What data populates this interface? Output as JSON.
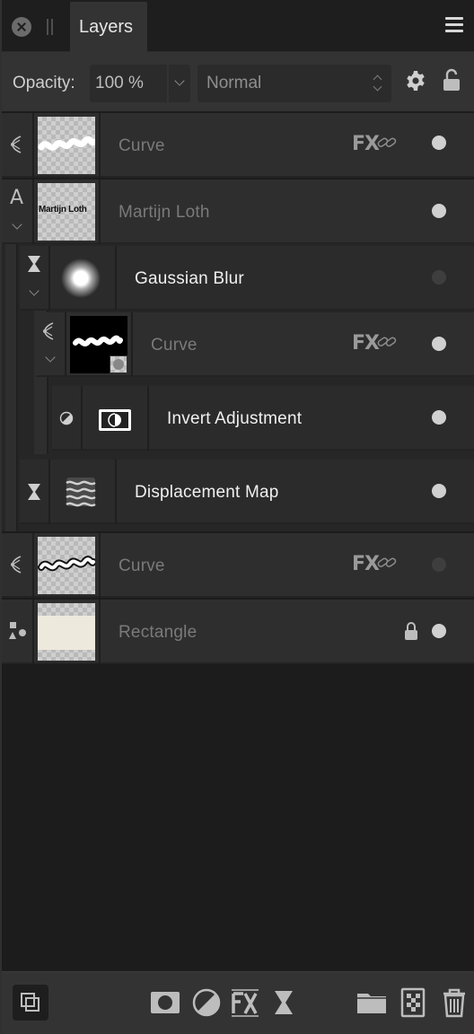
{
  "panel": {
    "tab_label": "Layers"
  },
  "options": {
    "opacity_label": "Opacity:",
    "opacity_value": "100 %",
    "blend_mode": "Normal"
  },
  "layers": [
    {
      "name": "Curve",
      "type": "curve",
      "icon": "pen-node-icon",
      "fx": true,
      "linked": true,
      "visible": true
    },
    {
      "name": "Martijn Loth",
      "type": "text",
      "icon": "text-icon",
      "thumb_text": "Martijn Loth",
      "expanded": true,
      "visible": true
    },
    {
      "name": "Gaussian Blur",
      "type": "filter",
      "icon": "hourglass-icon",
      "expanded": true,
      "visible": false
    },
    {
      "name": "Curve",
      "type": "curve",
      "icon": "pen-node-icon",
      "fx": true,
      "linked": true,
      "expanded": true,
      "visible": true
    },
    {
      "name": "Invert Adjustment",
      "type": "adjustment",
      "icon": "adjustment-icon",
      "visible": true
    },
    {
      "name": "Displacement Map",
      "type": "filter",
      "icon": "hourglass-icon",
      "visible": true
    },
    {
      "name": "Curve",
      "type": "curve",
      "icon": "pen-node-icon",
      "fx": true,
      "linked": true,
      "visible": false
    },
    {
      "name": "Rectangle",
      "type": "shape",
      "icon": "shapes-icon",
      "locked": true,
      "visible": true
    }
  ],
  "fx_label": "FX",
  "toolbar": [
    "arrange-icon",
    "mask-icon",
    "adjustment-icon",
    "fx-icon",
    "live-filter-icon",
    "folder-icon",
    "pixel-layer-icon",
    "trash-icon"
  ],
  "colors": {
    "panel_bg": "#1c1c1c",
    "row_bg": "#2e2e2e",
    "accent_text": "#f0f0f0",
    "dim_text": "#7a7a7a"
  }
}
